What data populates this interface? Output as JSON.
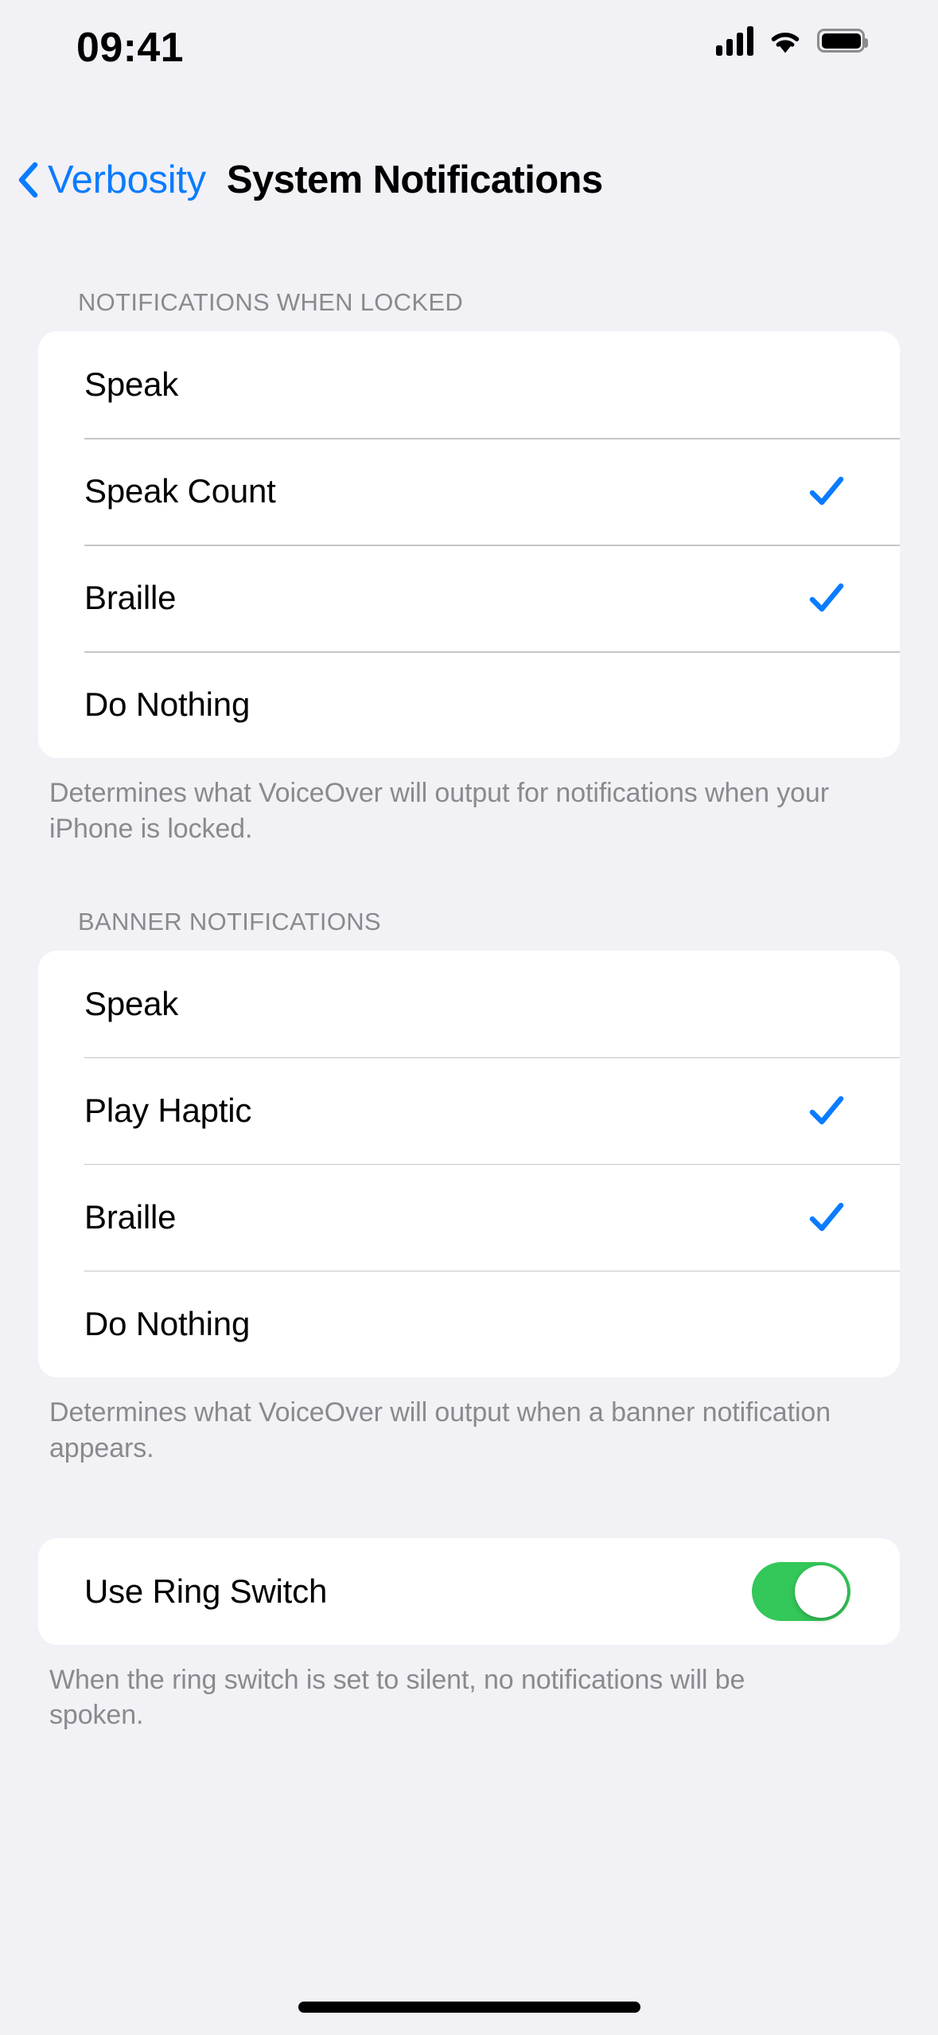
{
  "status_bar": {
    "time": "09:41",
    "cellular_icon": "cellular-bars-icon",
    "wifi_icon": "wifi-icon",
    "battery_icon": "battery-full-icon"
  },
  "nav": {
    "back_label": "Verbosity",
    "back_icon": "chevron-left-icon",
    "title": "System Notifications"
  },
  "sections": [
    {
      "header": "NOTIFICATIONS WHEN LOCKED",
      "rows": [
        {
          "label": "Speak",
          "checked": false
        },
        {
          "label": "Speak Count",
          "checked": true
        },
        {
          "label": "Braille",
          "checked": true
        },
        {
          "label": "Do Nothing",
          "checked": false
        }
      ],
      "footer": "Determines what VoiceOver will output for notifications when your iPhone is locked."
    },
    {
      "header": "BANNER NOTIFICATIONS",
      "rows": [
        {
          "label": "Speak",
          "checked": false
        },
        {
          "label": "Play Haptic",
          "checked": true
        },
        {
          "label": "Braille",
          "checked": true
        },
        {
          "label": "Do Nothing",
          "checked": false
        }
      ],
      "footer": "Determines what VoiceOver will output when a banner notification appears."
    }
  ],
  "ring_switch": {
    "label": "Use Ring Switch",
    "value": "on",
    "footer": "When the ring switch is set to silent, no notifications will be spoken."
  },
  "colors": {
    "background": "#F2F1F6",
    "card": "#FFFFFF",
    "accent_blue": "#0A7CFF",
    "checkmark_blue": "#0A7CFF",
    "toggle_green": "#34C759",
    "secondary_text": "#8A8A8E",
    "separator": "#C6C6C8"
  }
}
